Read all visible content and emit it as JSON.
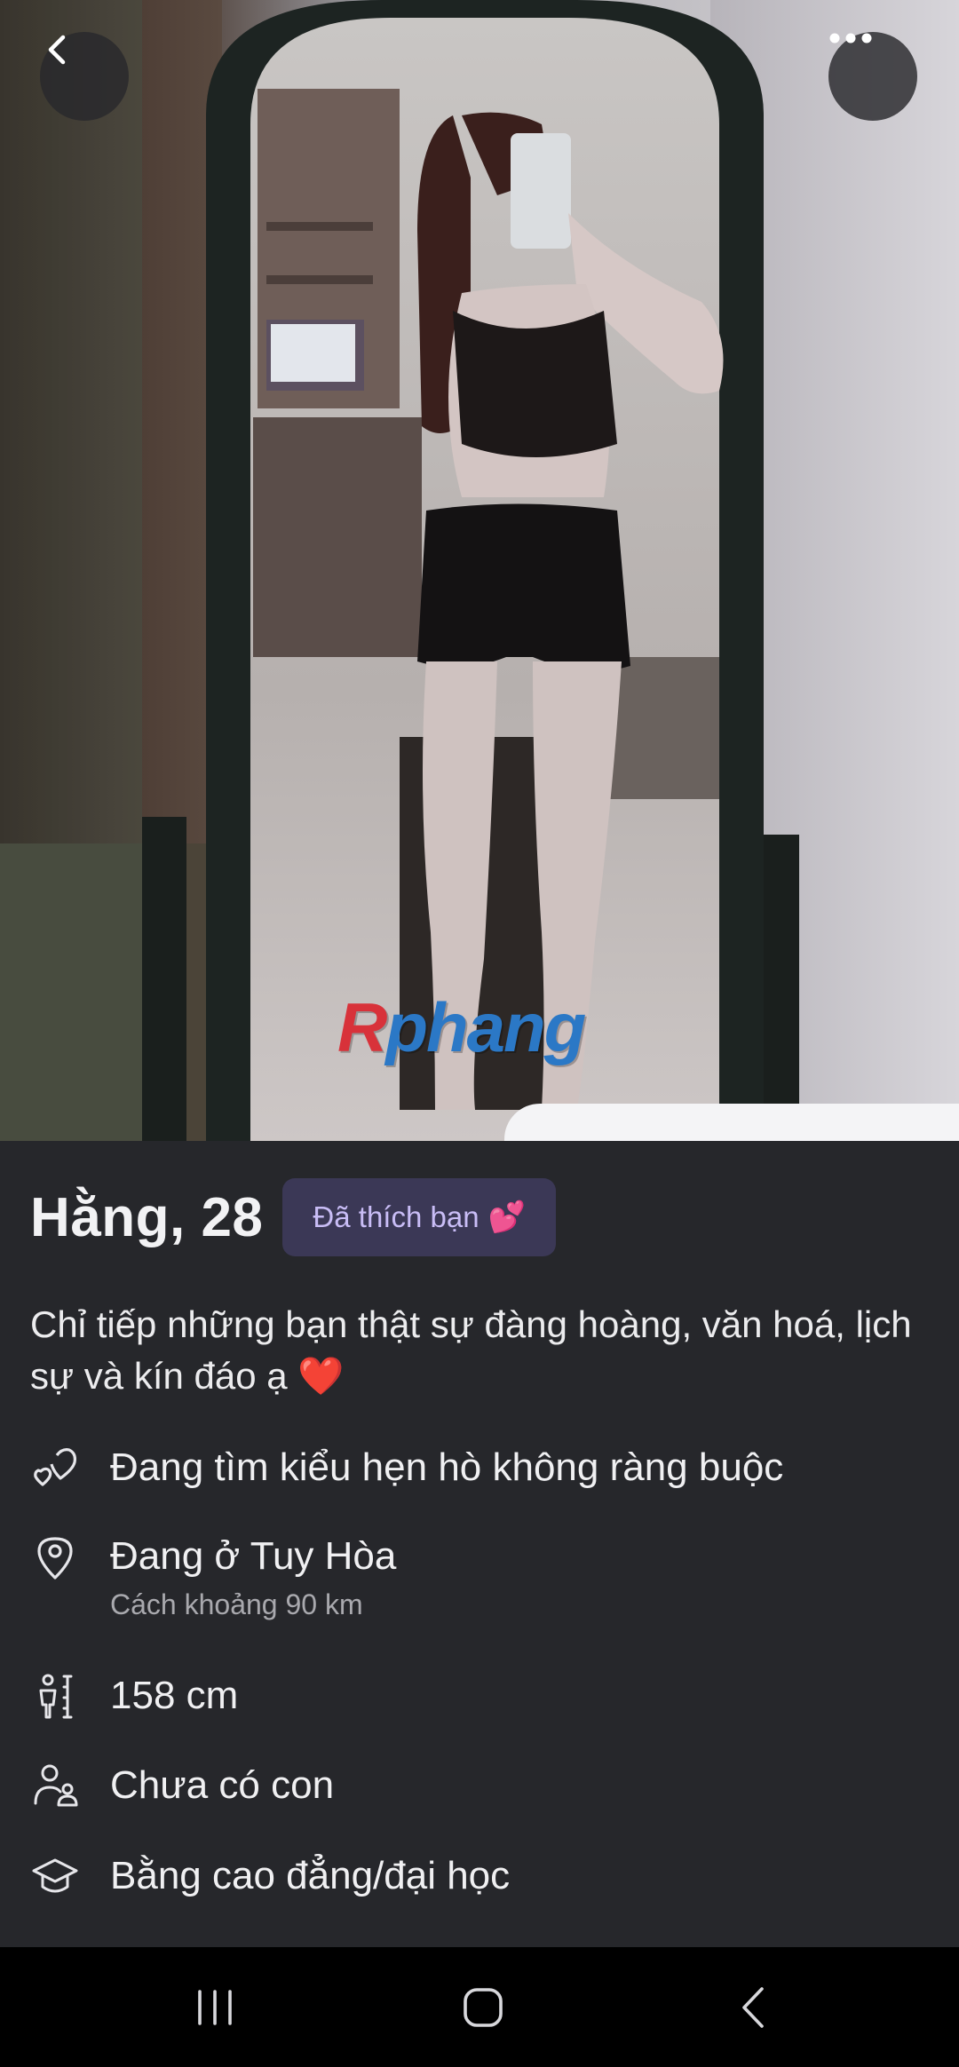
{
  "photo": {
    "watermark_first": "R",
    "watermark_rest": "phang",
    "back_icon": "chevron-left-icon",
    "more_icon": "more-horizontal-icon"
  },
  "profile": {
    "name_age": "Hằng, 28",
    "liked_badge": "Đã thích bạn",
    "liked_badge_emoji": "💕",
    "bio": "Chỉ tiếp những bạn thật sự đàng hoàng, văn hoá, lịch sự và kín đáo ạ",
    "bio_emoji": "❤️"
  },
  "details": {
    "looking_for": "Đang tìm kiểu hẹn hò không ràng buộc",
    "location": "Đang ở Tuy Hòa",
    "distance": "Cách  khoảng 90 km",
    "height": "158 cm",
    "children": "Chưa có con",
    "education": "Bằng cao đẳng/đại học"
  },
  "colors": {
    "background": "#26272b",
    "badge_bg": "#3b3856",
    "badge_text": "#c9bdf6",
    "text_primary": "#f0f0f2",
    "text_secondary": "#a9a9ae"
  },
  "navbar": {
    "recents_icon": "recent-apps-icon",
    "home_icon": "home-icon",
    "back_icon": "back-icon"
  }
}
